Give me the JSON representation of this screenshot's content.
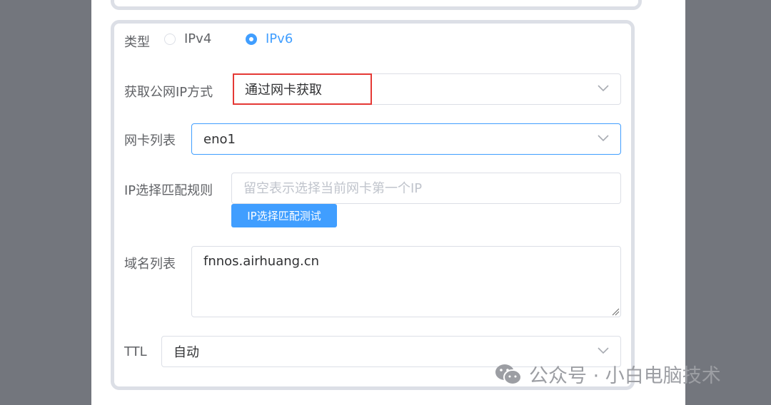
{
  "form": {
    "type_label": "类型",
    "type_options": [
      {
        "label": "IPv4",
        "checked": false
      },
      {
        "label": "IPv6",
        "checked": true
      }
    ],
    "method_label": "获取公网IP方式",
    "method_value": "通过网卡获取",
    "nic_label": "网卡列表",
    "nic_value": "eno1",
    "ip_rule_label": "IP选择匹配规则",
    "ip_rule_placeholder": "留空表示选择当前网卡第一个IP",
    "ip_rule_value": "",
    "test_button": "IP选择匹配测试",
    "domains_label": "域名列表",
    "domains_value": "fnnos.airhuang.cn",
    "ttl_label": "TTL",
    "ttl_value": "自动"
  },
  "watermark": {
    "text": "公众号 · 小白电脑技术",
    "icon": "wechat-icon"
  },
  "colors": {
    "accent": "#409eff",
    "highlight_box": "#e53935",
    "border": "#dcdfe6",
    "backdrop": "#73767d"
  }
}
